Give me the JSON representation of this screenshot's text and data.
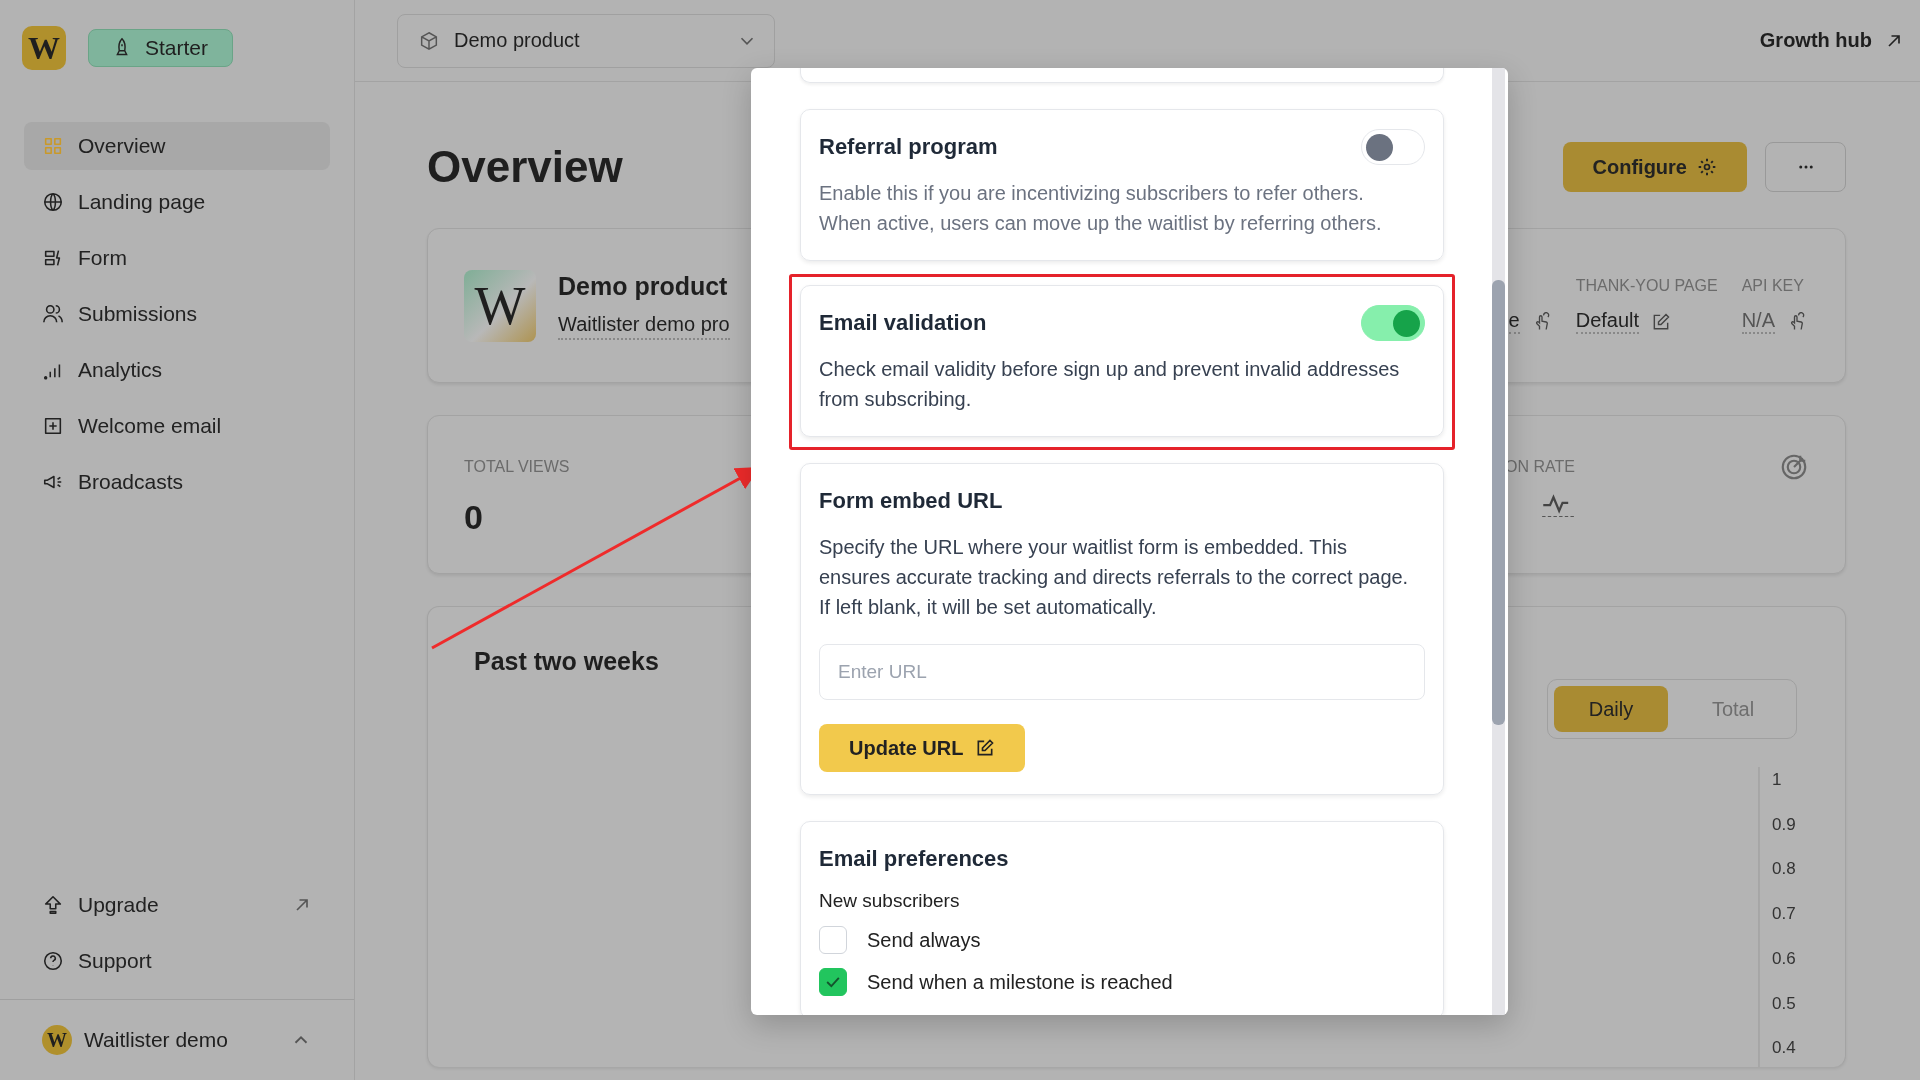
{
  "sidebar": {
    "brand_mark": "W",
    "plan_badge": "Starter",
    "items": [
      {
        "label": "Overview",
        "selected": true
      },
      {
        "label": "Landing page",
        "selected": false
      },
      {
        "label": "Form",
        "selected": false
      },
      {
        "label": "Submissions",
        "selected": false
      },
      {
        "label": "Analytics",
        "selected": false
      },
      {
        "label": "Welcome email",
        "selected": false
      },
      {
        "label": "Broadcasts",
        "selected": false
      }
    ],
    "bottom_items": [
      {
        "label": "Upgrade",
        "external": true
      },
      {
        "label": "Support",
        "external": false
      }
    ],
    "account": {
      "brand_mark": "W",
      "name": "Waitlister demo",
      "expanded": true
    }
  },
  "header": {
    "product_select": "Demo product",
    "link": "Growth hub"
  },
  "page": {
    "title": "Overview",
    "configure_button": "Configure"
  },
  "product_card": {
    "brand_mark": "W",
    "name": "Demo product",
    "description": "Waitlister demo pro",
    "fields": [
      {
        "value": "e"
      },
      {
        "label": "THANK-YOU PAGE",
        "value": "Default"
      },
      {
        "label": "API KEY",
        "value": "N/A"
      }
    ]
  },
  "stats_card": {
    "metrics": [
      {
        "label": "TOTAL VIEWS",
        "value": "0"
      },
      {
        "label": "ON RATE"
      }
    ]
  },
  "chart_card": {
    "title": "Past two weeks",
    "modes": [
      {
        "label": "Daily",
        "selected": true
      },
      {
        "label": "Total",
        "selected": false
      }
    ],
    "y_axis_labels": [
      "1",
      "0.9",
      "0.8",
      "0.7",
      "0.6",
      "0.5",
      "0.4"
    ]
  },
  "modal": {
    "settings": [
      {
        "kind": "toggle",
        "title": "Referral program",
        "description": "Enable this if you are incentivizing subscribers to refer others. When active, users can move up the waitlist by referring others.",
        "on": false,
        "highlighted": false
      },
      {
        "kind": "toggle",
        "title": "Email validation",
        "description": "Check email validity before sign up and prevent invalid addresses from subscribing.",
        "on": true,
        "highlighted": true
      },
      {
        "kind": "url",
        "title": "Form embed URL",
        "description": "Specify the URL where your waitlist form is embedded. This ensures accurate tracking and directs referrals to the correct page. If left blank, it will be set automatically.",
        "placeholder": "Enter URL",
        "button": "Update URL"
      },
      {
        "kind": "preferences",
        "title": "Email preferences",
        "subtitle": "New subscribers",
        "options": [
          {
            "label": "Send always",
            "checked": false
          },
          {
            "label": "Send when a milestone is reached",
            "checked": true
          }
        ]
      }
    ]
  }
}
